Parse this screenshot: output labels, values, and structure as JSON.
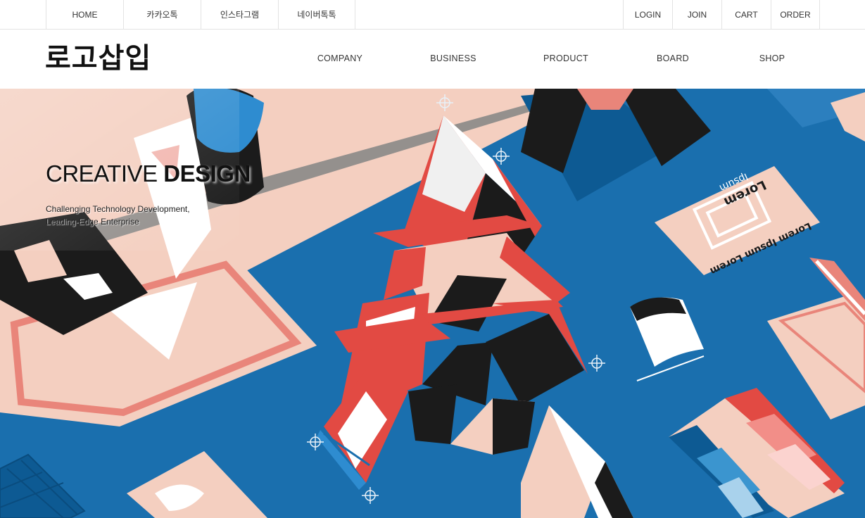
{
  "utility_nav": {
    "left": [
      "HOME",
      "카카오톡",
      "인스타그램",
      "네이버톡톡"
    ],
    "right": [
      "LOGIN",
      "JOIN",
      "CART",
      "ORDER"
    ]
  },
  "header": {
    "logo": "로고삽입",
    "menu": [
      "COMPANY",
      "BUSINESS",
      "PRODUCT",
      "BOARD",
      "SHOP"
    ]
  },
  "hero": {
    "title_light": "CREATIVE",
    "title_bold": "DESIGN",
    "subtitle_lines": [
      "Challenging Technology Development,",
      "Leading-Edge Enterprise"
    ],
    "illustration_texts": [
      "Lorem",
      "Ipsum",
      "Lorem Ipsum Lorem"
    ]
  },
  "colors": {
    "blue": "#1a6fae",
    "peach": "#f4cfc0",
    "salmon": "#e9857a",
    "red": "#e24a43",
    "black": "#1b1b1b"
  }
}
